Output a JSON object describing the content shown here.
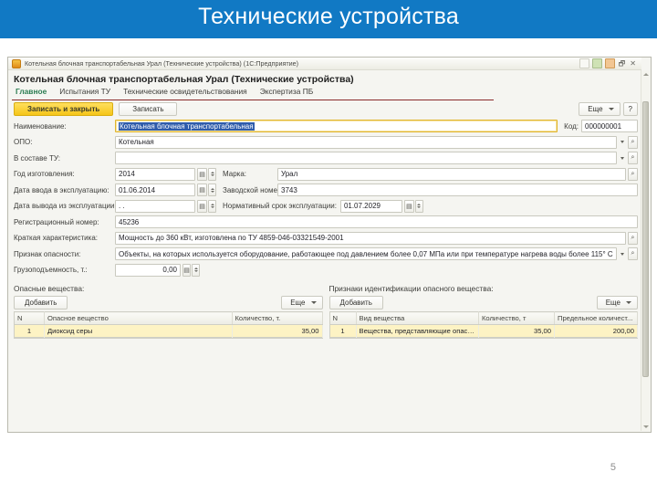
{
  "slide": {
    "title": "Технические устройства",
    "page_number": "5",
    "banner_color": "#1179c4"
  },
  "window": {
    "titlebar_text": "Котельная блочная транспортабельная Урал (Технические устройства)  (1С:Предприятие)",
    "app_icon": "1c-app-icon",
    "sys_icons": [
      "help-small-icon",
      "window-green-icon",
      "window-orange-icon"
    ],
    "restore_label": "🗗",
    "close_label": "✕",
    "document_title": "Котельная блочная транспортабельная Урал (Технические устройства)"
  },
  "tabs": [
    {
      "label": "Главное",
      "active": true
    },
    {
      "label": "Испытания ТУ",
      "active": false
    },
    {
      "label": "Технические освидетельствования",
      "active": false
    },
    {
      "label": "Экспертиза ПБ",
      "active": false
    }
  ],
  "toolbar": {
    "save_and_close_label": "Записать и закрыть",
    "save_label": "Записать",
    "more_label": "Еще",
    "help_label": "?"
  },
  "form": {
    "name": {
      "label": "Наименование:",
      "value": "Котельная блочная транспортабельная",
      "selected": true
    },
    "code": {
      "label": "Код:",
      "value": "000000001"
    },
    "opo": {
      "label": "ОПО:",
      "value": "Котельная"
    },
    "part_of_tu": {
      "label": "В составе ТУ:",
      "value": ""
    },
    "manufacture_year": {
      "label": "Год изготовления:",
      "value": "2014"
    },
    "brand": {
      "label": "Марка:",
      "value": "Урал"
    },
    "commission_date": {
      "label": "Дата ввода в эксплуатацию:",
      "value": "01.06.2014"
    },
    "factory_number": {
      "label": "Заводской номер:",
      "value": "3743"
    },
    "decommission_date": {
      "label": "Дата вывода из эксплуатации:",
      "value": ".   ."
    },
    "normative_term": {
      "label": "Нормативный срок эксплуатации:",
      "value": "01.07.2029"
    },
    "registration_number": {
      "label": "Регистрационный номер:",
      "value": "45236"
    },
    "short_characteristic": {
      "label": "Краткая характеристика:",
      "value": "Мощность до 360 кВт, изготовлена по ТУ 4859-046-03321549-2001"
    },
    "hazard_sign": {
      "label": "Признак опасности:",
      "value": "Объекты, на которых используется оборудование, работающее под давлением более 0,07 МПа или при температуре нагрева воды более 115° С"
    },
    "load_capacity": {
      "label": "Грузоподъемность, т.:",
      "value": "0,00"
    }
  },
  "hazardous_substances": {
    "section_label": "Опасные вещества:",
    "add_label": "Добавить",
    "more_label": "Еще",
    "columns": [
      "N",
      "Опасное вещество",
      "Количество, т."
    ],
    "rows": [
      {
        "n": "1",
        "substance": "Диоксид серы",
        "quantity": "35,00",
        "selected": true
      }
    ]
  },
  "identification_signs": {
    "section_label": "Признаки идентификации опасного вещества:",
    "add_label": "Добавить",
    "more_label": "Еще",
    "columns": [
      "N",
      "Вид вещества",
      "Количество, т",
      "Предельное количест..."
    ],
    "rows": [
      {
        "n": "1",
        "kind": "Вещества, представляющие опасность для окружа...",
        "quantity": "35,00",
        "limit": "200,00",
        "selected": true
      }
    ]
  }
}
